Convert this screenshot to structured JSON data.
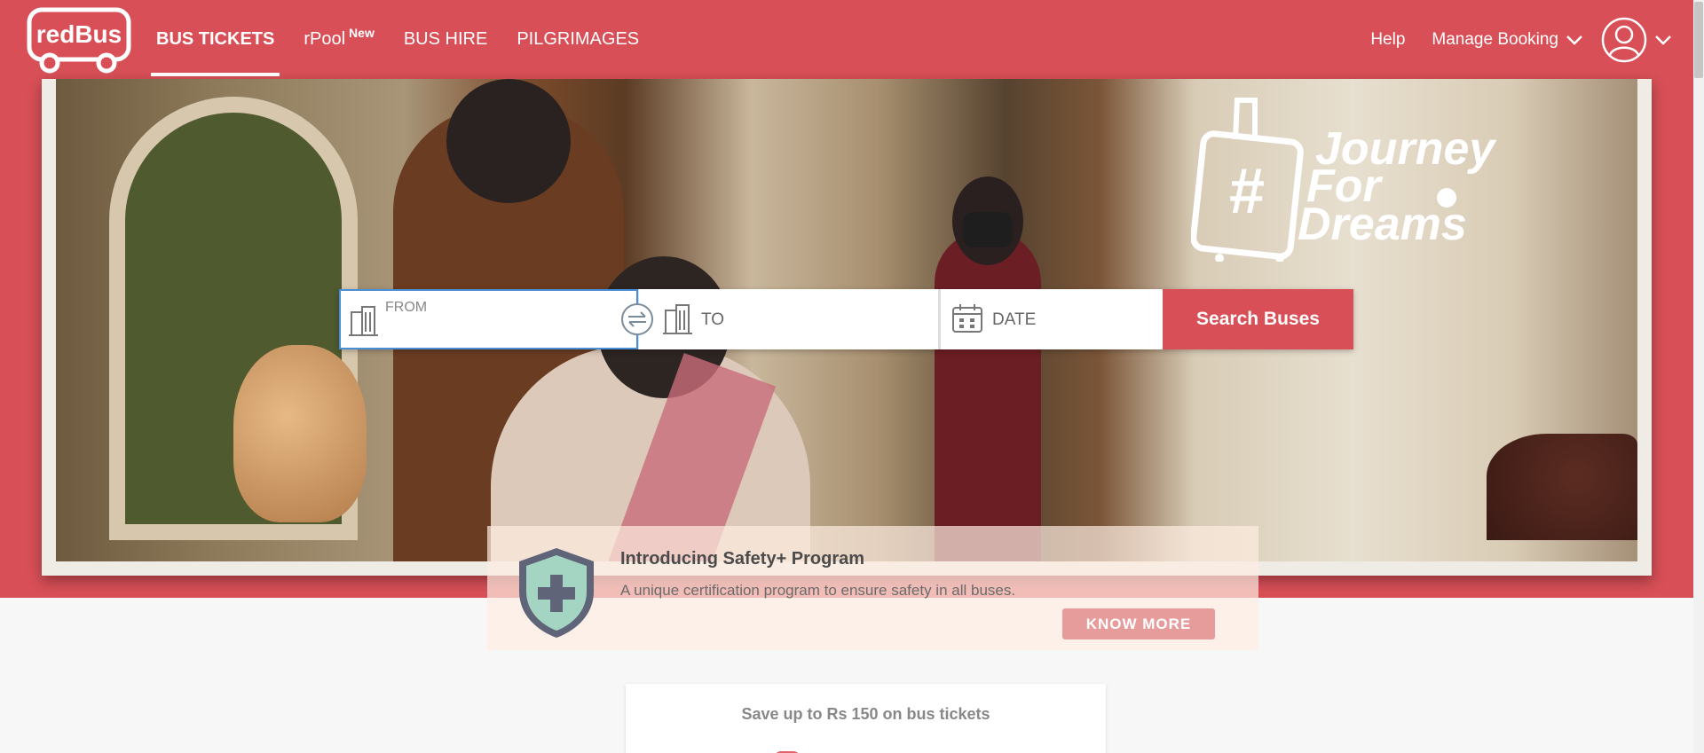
{
  "header": {
    "logo_text": "redBus",
    "nav": [
      {
        "label": "BUS TICKETS",
        "active": true
      },
      {
        "label": "rPool",
        "badge": "New"
      },
      {
        "label": "BUS HIRE"
      },
      {
        "label": "PILGRIMAGES"
      }
    ],
    "help": "Help",
    "manage_booking": "Manage Booking"
  },
  "hero": {
    "campaign_text": [
      "Journey",
      "For",
      "Dreams"
    ],
    "campaign_hashtag": "#"
  },
  "search": {
    "from_label": "FROM",
    "from_value": "",
    "to_placeholder": "TO",
    "date_placeholder": "DATE",
    "button": "Search Buses"
  },
  "safety": {
    "title": "Introducing Safety+ Program",
    "description": "A unique certification program to ensure safety in all buses.",
    "button": "KNOW MORE"
  },
  "offer": {
    "text": "Save up to Rs 150 on bus tickets"
  },
  "colors": {
    "brand_red": "#d84f57",
    "search_border": "#4a8fd6",
    "know_more_bg": "#e79c9c"
  }
}
